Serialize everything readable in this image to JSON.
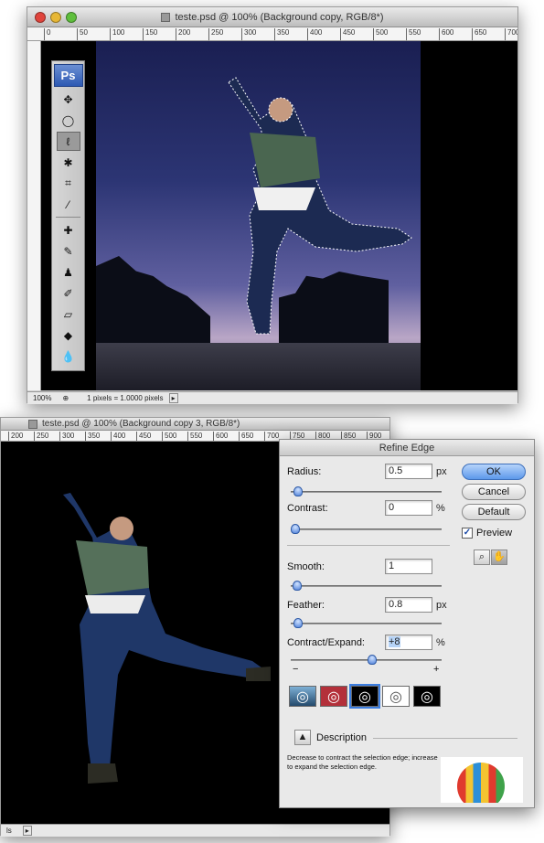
{
  "top_window": {
    "title": "teste.psd @ 100% (Background copy, RGB/8*)",
    "ruler_ticks": [
      "0",
      "50",
      "100",
      "150",
      "200",
      "250",
      "300",
      "350",
      "400",
      "450",
      "500",
      "550",
      "600",
      "650",
      "700"
    ],
    "status_zoom": "100%",
    "status_info": "1 pixels = 1.0000 pixels"
  },
  "toolbar": {
    "logo": "Ps",
    "tools": [
      {
        "name": "move-tool-icon",
        "glyph": "✥"
      },
      {
        "name": "marquee-tool-icon",
        "glyph": "◯"
      },
      {
        "name": "lasso-tool-icon",
        "glyph": "ℓ"
      },
      {
        "name": "magic-wand-tool-icon",
        "glyph": "✱"
      },
      {
        "name": "crop-tool-icon",
        "glyph": "⌗"
      },
      {
        "name": "slice-tool-icon",
        "glyph": "⁄"
      },
      {
        "name": "healing-brush-tool-icon",
        "glyph": "✚"
      },
      {
        "name": "brush-tool-icon",
        "glyph": "✎"
      },
      {
        "name": "clone-stamp-tool-icon",
        "glyph": "♟"
      },
      {
        "name": "history-brush-tool-icon",
        "glyph": "✐"
      },
      {
        "name": "eraser-tool-icon",
        "glyph": "▱"
      },
      {
        "name": "paint-bucket-tool-icon",
        "glyph": "◆"
      },
      {
        "name": "blur-tool-icon",
        "glyph": "💧"
      }
    ]
  },
  "bottom_window": {
    "title": "teste.psd @ 100% (Background copy 3, RGB/8*)",
    "ruler_ticks": [
      "200",
      "250",
      "300",
      "350",
      "400",
      "450",
      "500",
      "550",
      "600",
      "650",
      "700",
      "750",
      "800",
      "850",
      "900"
    ]
  },
  "dialog": {
    "title": "Refine Edge",
    "radius": {
      "label": "Radius:",
      "value": "0.5",
      "unit": "px",
      "level": 0.02
    },
    "contrast": {
      "label": "Contrast:",
      "value": "0",
      "unit": "%",
      "level": 0.0
    },
    "smooth": {
      "label": "Smooth:",
      "value": "1",
      "unit": "",
      "level": 0.01
    },
    "feather": {
      "label": "Feather:",
      "value": "0.8",
      "unit": "px",
      "level": 0.02
    },
    "contract_expand": {
      "label": "Contract/Expand:",
      "value": "+8",
      "unit": "%",
      "level": 0.54,
      "minus": "−",
      "plus": "+"
    },
    "ok": "OK",
    "cancel": "Cancel",
    "default": "Default",
    "preview_label": "Preview",
    "preview_checked": "✓",
    "description_header": "Description",
    "description_text": "Decrease to contract the selection edge; increase to expand the selection edge.",
    "accent": "#3b7de0"
  }
}
